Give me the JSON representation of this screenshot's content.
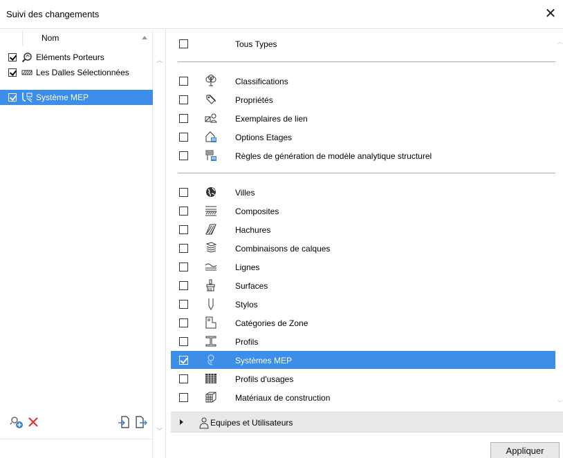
{
  "window": {
    "title": "Suivi des changements",
    "close_glyph": "✕"
  },
  "left_panel": {
    "column_header": "Nom",
    "items": [
      {
        "label": "Eléments Porteurs",
        "checked": true,
        "selected": false,
        "icon": "magnifier-icon"
      },
      {
        "label": "Les Dalles Sélectionnées",
        "checked": true,
        "selected": false,
        "icon": "hatch-icon"
      },
      {
        "label": "Système MEP",
        "checked": true,
        "selected": true,
        "icon": "mep-system-icon"
      }
    ],
    "toolbar": [
      {
        "name": "add-set-icon"
      },
      {
        "name": "delete-icon",
        "color": "#e8312f"
      },
      {
        "name": "import-icon"
      },
      {
        "name": "export-icon"
      }
    ]
  },
  "right_panel": {
    "all_types": {
      "label": "Tous Types",
      "checked": false
    },
    "group1": [
      {
        "label": "Classifications",
        "icon": "tree-icon"
      },
      {
        "label": "Propriétés",
        "icon": "tag-icon"
      },
      {
        "label": "Exemplaires de lien",
        "icon": "link-instance-icon"
      },
      {
        "label": "Options Etages",
        "icon": "story-options-icon"
      },
      {
        "label": "Règles de génération de modèle analytique structurel",
        "icon": "structural-rules-icon"
      }
    ],
    "group2": [
      {
        "label": "Villes",
        "icon": "globe-icon"
      },
      {
        "label": "Composites",
        "icon": "composite-icon"
      },
      {
        "label": "Hachures",
        "icon": "hatch-pattern-icon"
      },
      {
        "label": "Combinaisons de calques",
        "icon": "layers-icon"
      },
      {
        "label": "Lignes",
        "icon": "lines-icon"
      },
      {
        "label": "Surfaces",
        "icon": "brush-icon"
      },
      {
        "label": "Stylos",
        "icon": "pen-icon"
      },
      {
        "label": "Catégories de Zone",
        "icon": "zone-category-icon"
      },
      {
        "label": "Profils",
        "icon": "profile-icon"
      },
      {
        "label": "Systèmes MEP",
        "icon": "mep-icon",
        "checked": true,
        "selected": true
      },
      {
        "label": "Profils d'usages",
        "icon": "usage-profile-icon"
      },
      {
        "label": "Matériaux de construction",
        "icon": "building-material-icon"
      }
    ],
    "group_header": {
      "label": "Equipes et Utilisateurs",
      "icon": "users-icon"
    },
    "apply_label": "Appliquer"
  },
  "colors": {
    "selection": "#3d8ee8",
    "delete": "#e8312f"
  }
}
